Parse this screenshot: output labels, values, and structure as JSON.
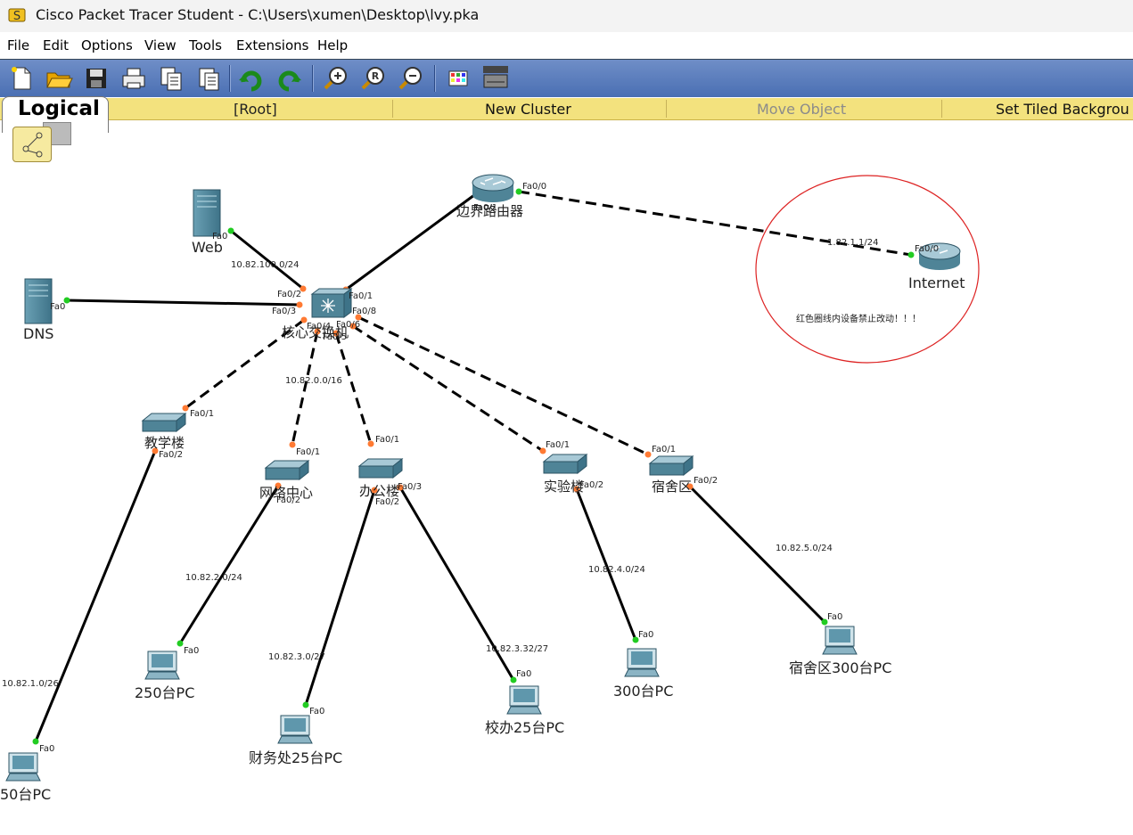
{
  "window": {
    "title": "Cisco Packet Tracer Student - C:\\Users\\xumen\\Desktop\\lvy.pka"
  },
  "menu": [
    "File",
    "Edit",
    "Options",
    "View",
    "Tools",
    "Extensions",
    "Help"
  ],
  "toolbar": [
    "new-icon",
    "open-icon",
    "save-icon",
    "print-icon",
    "copy-icon",
    "paste-icon",
    "undo-icon",
    "redo-icon",
    "zoom-in-icon",
    "zoom-reset-icon",
    "zoom-out-icon",
    "palette-icon",
    "device-dialog-icon"
  ],
  "logical_bar": {
    "tab": "Logical",
    "root": "[Root]",
    "new_cluster": "New Cluster",
    "move_object": "Move Object",
    "set_tiled": "Set Tiled Backgrou"
  },
  "devices": {
    "web": "Web",
    "dns": "DNS",
    "edge_router": "边界路由器",
    "internet": "Internet",
    "core": "核心交换机",
    "teach": "教学楼",
    "netcenter": "网络中心",
    "office": "办公楼",
    "lab": "实验楼",
    "dorm": "宿舍区",
    "pc250": "250台PC",
    "finance": "财务处25台PC",
    "xiaoban": "校办25台PC",
    "pc300": "300台PC",
    "dorm300": "宿舍区300台PC",
    "pc50": "50台PC"
  },
  "ports": {
    "web_fa0": "Fa0",
    "dns_fa0": "Fa0",
    "r_fa00": "Fa0/0",
    "r_fa01": "Fa0/1",
    "inet_fa00": "Fa0/0",
    "core_fa01": "Fa0/1",
    "core_fa02": "Fa0/2",
    "core_fa03": "Fa0/3",
    "core_fa04": "Fa0/4",
    "core_fa05": "Fa0/5",
    "core_fa06": "Fa0/6",
    "core_fa08": "Fa0/8",
    "teach_fa01": "Fa0/1",
    "teach_fa02": "Fa0/2",
    "net_fa01": "Fa0/1",
    "net_fa02": "Fa0/2",
    "off_fa01": "Fa0/1",
    "off_fa02": "Fa0/2",
    "off_fa03": "Fa0/3",
    "lab_fa01": "Fa0/1",
    "lab_fa02": "Fa0/2",
    "dorm_fa01": "Fa0/1",
    "dorm_fa02": "Fa0/2",
    "pc_fa0": "Fa0"
  },
  "networks": {
    "web_net": "10.82.100.0/24",
    "inet_ip": "1.82.1.1/24",
    "core_net": "10.82.0.0/16",
    "net2": "10.82.2.0/24",
    "net3": "10.82.3.0/27",
    "net332": "10.82.3.32/27",
    "net4": "10.82.4.0/24",
    "net5": "10.82.5.0/24",
    "net1": "10.82.1.0/26"
  },
  "note": "红色圈线内设备禁止改动！！！",
  "colors": {
    "toolbar": "#4a6fb3",
    "logbar": "#f3e27e",
    "link": "#000000",
    "port_up": "#22cc22",
    "port_orange": "#ff7a33",
    "note_circle": "#dd2222"
  }
}
